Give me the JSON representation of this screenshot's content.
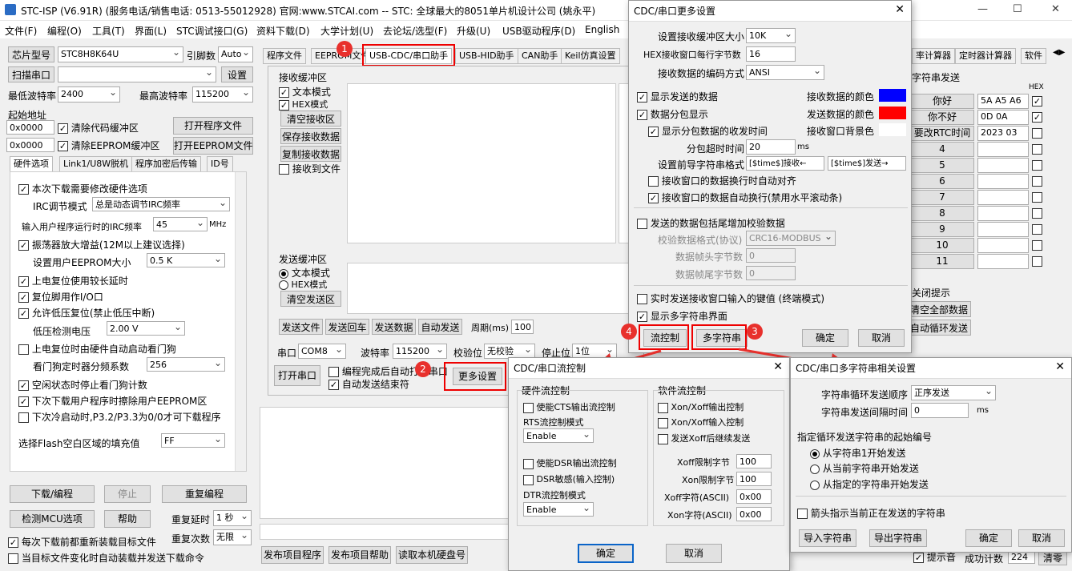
{
  "window": {
    "title": "STC-ISP (V6.91R) (服务电话/销售电话: 0513-55012928) 官网:www.STCAI.com  -- STC: 全球最大的8051单片机设计公司 (姚永平)"
  },
  "menu": [
    "文件(F)",
    "编程(O)",
    "工具(T)",
    "界面(L)",
    "STC调试接口(G)",
    "资料下载(D)",
    "大学计划(U)",
    "去论坛/选型(F)",
    "升级(U)",
    "USB驱动程序(D)",
    "English"
  ],
  "left": {
    "chip_label": "芯片型号",
    "chip_value": "STC8H8K64U",
    "engine_label": "引脚数",
    "engine_value": "Auto",
    "scan_label": "扫描串口",
    "settings": "设置",
    "minbaud_label": "最低波特率",
    "minbaud": "2400",
    "maxbaud_label": "最高波特率",
    "maxbaud": "115200",
    "start_label": "起始地址",
    "addr1": "0x0000",
    "clear_code": "清除代码缓冲区",
    "open_prog": "打开程序文件",
    "addr2": "0x0000",
    "clear_eeprom": "清除EEPROM缓冲区",
    "open_eeprom": "打开EEPROM文件",
    "tabs": [
      "硬件选项",
      "Link1/U8W脱机",
      "程序加密后传输",
      "ID号"
    ],
    "opts": [
      {
        "t": "本次下载需要修改硬件选项",
        "c": true
      },
      {
        "t": "IRC调节模式",
        "v": "总是动态调节IRC频率"
      },
      {
        "t": "输入用户程序运行时的IRC频率",
        "v": "45",
        "u": "MHz"
      },
      {
        "t": "振荡器放大增益(12M以上建议选择)",
        "c": true
      },
      {
        "t": "设置用户EEPROM大小",
        "v": "0.5 K"
      },
      {
        "t": "上电复位使用较长延时",
        "c": true
      },
      {
        "t": "复位脚用作I/O口",
        "c": true
      },
      {
        "t": "允许低压复位(禁止低压中断)",
        "c": true
      },
      {
        "t": "低压检测电压",
        "v": "2.00 V"
      },
      {
        "t": "上电复位时由硬件自动启动看门狗",
        "c": false
      },
      {
        "t": "看门狗定时器分频系数",
        "v": "256"
      },
      {
        "t": "空闲状态时停止看门狗计数",
        "c": true
      },
      {
        "t": "下次下载用户程序时擦除用户EEPROM区",
        "c": true
      },
      {
        "t": "下次冷启动时,P3.2/P3.3为0/0才可下载程序",
        "c": false
      }
    ],
    "flash_label": "选择Flash空白区域的填充值",
    "flash_value": "FF",
    "download": "下载/编程",
    "stop": "停止",
    "reprog": "重复编程",
    "detect": "检测MCU选项",
    "help": "帮助",
    "delay_label": "重复延时",
    "delay": "1 秒",
    "count_label": "重复次数",
    "count": "无限",
    "reload": "每次下载前都重新装载目标文件",
    "autoload": "当目标文件变化时自动装载并发送下载命令"
  },
  "tabs": [
    "程序文件",
    "EEPROM文件",
    "USB-CDC/串口助手",
    "USB-HID助手",
    "CAN助手",
    "Keil仿真设置"
  ],
  "tabs_right": [
    "率计算器",
    "定时器计算器",
    "软件"
  ],
  "recv": {
    "title": "接收缓冲区",
    "text_mode": "文本模式",
    "hex_mode": "HEX模式",
    "clear": "清空接收区",
    "save": "保存接收数据",
    "copy": "复制接收数据",
    "to_file": "接收到文件"
  },
  "send": {
    "title": "发送缓冲区",
    "text_mode": "文本模式",
    "hex_mode": "HEX模式",
    "clear": "清空发送区",
    "send_file": "发送文件",
    "send_cr": "发送回车",
    "send_data": "发送数据",
    "auto_send": "自动发送",
    "period_label": "周期(ms)",
    "period": "100"
  },
  "port": {
    "label": "串口",
    "value": "COM8",
    "baud_label": "波特率",
    "baud": "115200",
    "parity_label": "校验位",
    "parity": "无校验",
    "stop_label": "停止位",
    "stop": "1位",
    "open": "打开串口",
    "opt1": "编程完成后自动打开串口",
    "opt2": "自动发送结束符",
    "more": "更多设置"
  },
  "bottom_btns": [
    "发布项目程序",
    "发布项目帮助",
    "读取本机硬盘号"
  ],
  "multi": {
    "title": "字符串发送",
    "hex": "HEX",
    "rows": [
      {
        "label": "你好",
        "value": "5A A5 A6",
        "c": true
      },
      {
        "label": "你不好",
        "value": "0D 0A",
        "c": true
      },
      {
        "label": "要改RTC时间",
        "value": "2023 03 27",
        "c": false
      },
      {
        "label": "4",
        "value": "",
        "c": false
      },
      {
        "label": "5",
        "value": "",
        "c": false
      },
      {
        "label": "6",
        "value": "",
        "c": false
      },
      {
        "label": "7",
        "value": "",
        "c": false
      },
      {
        "label": "8",
        "value": "",
        "c": false
      },
      {
        "label": "9",
        "value": "",
        "c": false
      },
      {
        "label": "10",
        "value": "",
        "c": false
      },
      {
        "label": "11",
        "value": "",
        "c": false
      }
    ],
    "close_tip": "关闭提示",
    "clear_all": "清空全部数据",
    "auto_loop": "自动循环发送",
    "tip": "提示音",
    "success_label": "成功计数",
    "success": "224",
    "clear": "清零"
  },
  "more_dlg": {
    "title": "CDC/串口更多设置",
    "buf_label": "设置接收缓冲区大小",
    "buf": "10K",
    "hexline_label": "HEX接收窗口每行字节数",
    "hexline": "16",
    "enc_label": "接收数据的编码方式",
    "enc": "ANSI",
    "show_sent": "显示发送的数据",
    "recv_color": "接收数据的颜色",
    "split": "数据分包显示",
    "send_color": "发送数据的颜色",
    "split_time": "显示分包数据的收发时间",
    "bg_color": "接收窗口背景色",
    "timeout_label": "分包超时时间",
    "timeout": "20",
    "ms": "ms",
    "prefix_label": "设置前导字符串格式",
    "prefix_recv": "[$time$]接收←",
    "prefix_send": "[$time$]发送→",
    "wrap_align": "接收窗口的数据换行时自动对齐",
    "auto_wrap": "接收窗口的数据自动换行(禁用水平滚动条)",
    "checksum": "发送的数据包括尾增加校验数据",
    "chk_fmt_label": "校验数据格式(协议)",
    "chk_fmt": "CRC16-MODBUS",
    "head_label": "数据帧头字节数",
    "head": "0",
    "tail_label": "数据帧尾字节数",
    "tail": "0",
    "realtime": "实时发送接收窗口输入的键值 (终端模式)",
    "show_multi": "显示多字符串界面",
    "flow": "流控制",
    "multi": "多字符串",
    "ok": "确定",
    "cancel": "取消",
    "recv_hex": "#0000ff",
    "send_hex": "#ff0000",
    "bg_hex": "#ffffff"
  },
  "flow_dlg": {
    "title": "CDC/串口流控制",
    "hw": "硬件流控制",
    "sw": "软件流控制",
    "cts": "使能CTS输出流控制",
    "rts_label": "RTS流控制模式",
    "rts": "Enable",
    "dsr": "使能DSR输出流控制",
    "dsr_sens": "DSR敏感(输入控制)",
    "dtr_label": "DTR流控制模式",
    "dtr": "Enable",
    "xon_out": "Xon/Xoff输出控制",
    "xon_in": "Xon/Xoff输入控制",
    "xoff_cont": "发送Xoff后继续发送",
    "xoff_lim_label": "Xoff限制字节",
    "xoff_lim": "100",
    "xon_lim_label": "Xon限制字节",
    "xon_lim": "100",
    "xoff_char_label": "Xoff字符(ASCII)",
    "xoff_char": "0x00",
    "xon_char_label": "Xon字符(ASCII)",
    "xon_char": "0x00",
    "ok": "确定",
    "cancel": "取消"
  },
  "multi_dlg": {
    "title": "CDC/串口多字符串相关设置",
    "order_label": "字符串循环发送顺序",
    "order": "正序发送",
    "interval_label": "字符串发送间隔时间",
    "interval": "0",
    "ms": "ms",
    "start_title": "指定循环发送字符串的起始编号",
    "r1": "从字符串1开始发送",
    "r2": "从当前字符串开始发送",
    "r3": "从指定的字符串开始发送",
    "arrow": "箭头指示当前正在发送的字符串",
    "import": "导入字符串",
    "export": "导出字符串",
    "ok": "确定",
    "cancel": "取消"
  },
  "markers": [
    "1",
    "2",
    "3",
    "4"
  ]
}
